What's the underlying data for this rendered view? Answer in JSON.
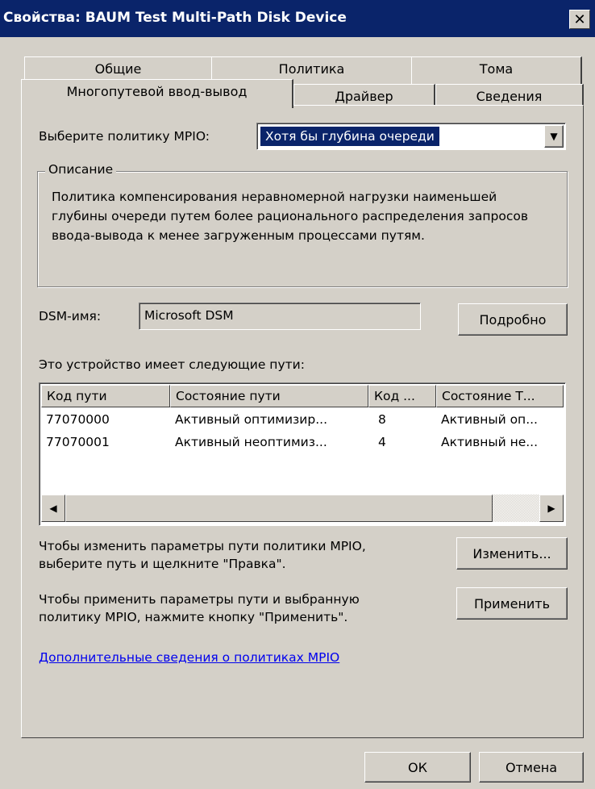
{
  "window": {
    "title": "Свойства: BAUM Test  Multi-Path Disk Device",
    "close_label": "✕"
  },
  "tabs": {
    "row1": [
      "Общие",
      "Политика",
      "Тома"
    ],
    "row2": [
      "Многопутевой ввод-вывод",
      "Драйвер",
      "Сведения"
    ],
    "active": "Многопутевой ввод-вывод"
  },
  "policy": {
    "label": "Выберите политику MPIO:",
    "selected": "Хотя бы глубина очереди"
  },
  "description": {
    "title": "Описание",
    "text": "Политика компенсирования неравномерной нагрузки наименьшей глубины очереди путем более рационального распределения запросов ввода-вывода к менее загруженным процессами путям."
  },
  "dsm": {
    "label": "DSM-имя:",
    "value": "Microsoft DSM",
    "details_button": "Подробно"
  },
  "paths": {
    "label": "Это устройство имеет следующие пути:",
    "columns": [
      "Код пути",
      "Состояние пути",
      "Код ...",
      "Состояние Т..."
    ],
    "rows": [
      [
        "77070000",
        "Активный оптимизир...",
        "8",
        "Активный оп..."
      ],
      [
        "77070001",
        "Активный неоптимиз...",
        "4",
        "Активный не..."
      ]
    ]
  },
  "edit": {
    "text1": "Чтобы изменить параметры пути политики MPIO,",
    "text2": "выберите путь и щелкните \"Правка\".",
    "button": "Изменить..."
  },
  "apply": {
    "text1": "Чтобы применить параметры пути и выбранную",
    "text2": "политику MPIO, нажмите кнопку \"Применить\".",
    "button": "Применить"
  },
  "link": "Дополнительные сведения о политиках MPIO",
  "footer": {
    "ok": "ОК",
    "cancel": "Отмена"
  },
  "colors": {
    "titlebar": "#0a246a",
    "face": "#d4d0c8",
    "selection": "#0a246a",
    "link": "#0000ee"
  }
}
